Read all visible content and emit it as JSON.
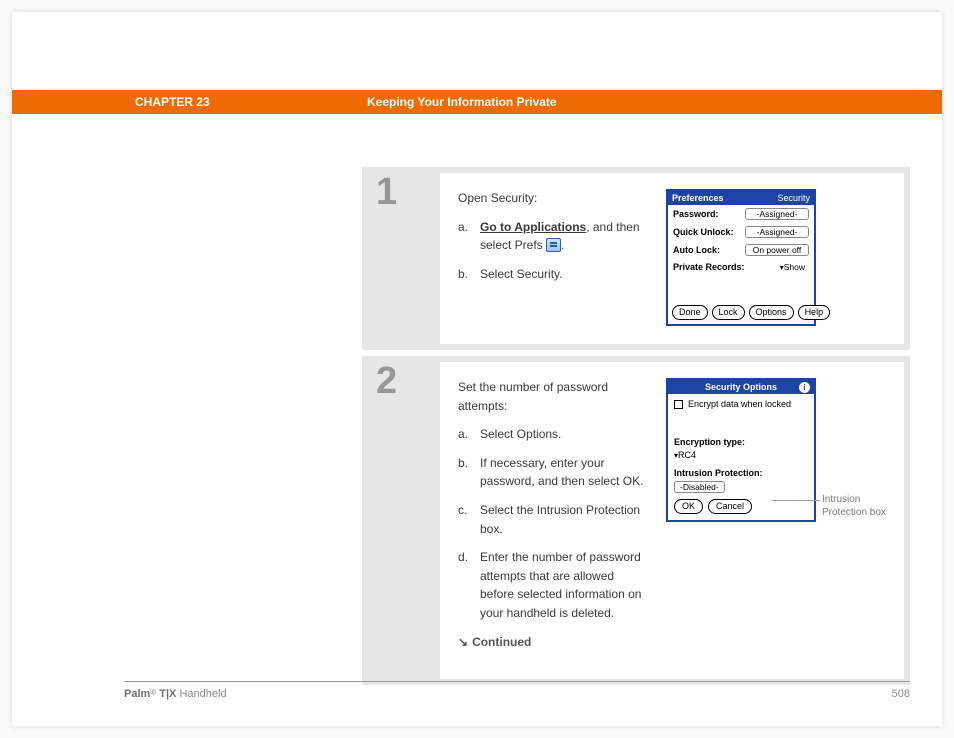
{
  "header": {
    "chapter": "CHAPTER 23",
    "title": "Keeping Your Information Private"
  },
  "steps": [
    {
      "num": "1",
      "intro": "Open Security:",
      "items": [
        {
          "label": "a.",
          "before": "",
          "link": "Go to Applications",
          "after": ", and then select Prefs ",
          "icon": true,
          "tail": "."
        },
        {
          "label": "b.",
          "text": "Select Security."
        }
      ],
      "palm": {
        "bar_left": "Preferences",
        "bar_right": "Security",
        "rows": [
          {
            "k": "Password:",
            "v": "-Assigned-"
          },
          {
            "k": "Quick Unlock:",
            "v": "-Assigned-"
          },
          {
            "k": "Auto Lock:",
            "v": "On power off"
          }
        ],
        "priv_label": "Private Records:",
        "priv_value": "Show",
        "buttons": [
          "Done",
          "Lock",
          "Options",
          "Help"
        ]
      }
    },
    {
      "num": "2",
      "intro": "Set the number of password attempts:",
      "items": [
        {
          "label": "a.",
          "text": "Select Options."
        },
        {
          "label": "b.",
          "text": "If necessary, enter your password, and then select OK."
        },
        {
          "label": "c.",
          "text": "Select the Intrusion Protection box."
        },
        {
          "label": "d.",
          "text": "Enter the number of password attempts that are allowed before selected information on your handheld is deleted."
        }
      ],
      "continued": "Continued",
      "palm2": {
        "title": "Security Options",
        "checkbox": "Encrypt data when locked",
        "enc_label": "Encryption type:",
        "enc_value": "RC4",
        "ip_label": "Intrusion Protection:",
        "ip_value": "-Disabled-",
        "buttons": [
          "OK",
          "Cancel"
        ]
      },
      "callout": "Intrusion Protection box"
    }
  ],
  "footer": {
    "product_bold": "Palm",
    "product_tx": " T|X",
    "product_rest": " Handheld",
    "page": "508"
  }
}
